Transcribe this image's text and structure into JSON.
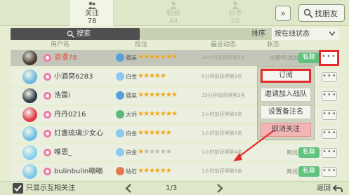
{
  "tabs": [
    {
      "label": "关注",
      "count": "78",
      "icon": "user-icon",
      "active": true
    },
    {
      "label": "粉丝",
      "count": "44",
      "icon": "user-icon",
      "active": false
    },
    {
      "label": "对手",
      "count": "20",
      "icon": "user-icon",
      "active": false
    }
  ],
  "toolbar": {
    "more_label": "»",
    "find_friend_label": "找朋友"
  },
  "search": {
    "placeholder": "搜索",
    "sort_label": "排序",
    "sort_value": "按在线状态"
  },
  "columns": {
    "username": "用户名",
    "rank": "段位",
    "activity": "最近动态",
    "status": "状态"
  },
  "rows": [
    {
      "name": "浪漫78",
      "rank": "猜英",
      "stars_on": 7,
      "stars_total": 7,
      "activity": "14小时前获得第3名",
      "status": "比赛中(团战)",
      "summon": "私聊",
      "avatar_color": "#4a3a30",
      "rank_color": "#5aa0d8",
      "name_red": true
    },
    {
      "name": "小酒窝6283",
      "rank": "白金",
      "stars_on": 5,
      "stars_total": 5,
      "activity": "5分钟前获得第3名",
      "status": "",
      "summon": "",
      "avatar_color": "#6cb7e0",
      "rank_color": "#8ec8f0",
      "name_red": false
    },
    {
      "name": "浩霆i",
      "rank": "猜英",
      "stars_on": 7,
      "stars_total": 7,
      "activity": "35分钟前获得第3名",
      "status": "",
      "summon": "",
      "avatar_color": "#2e3a44",
      "rank_color": "#5aa0d8",
      "name_red": false
    },
    {
      "name": "丹丹0216",
      "rank": "大师",
      "stars_on": 7,
      "stars_total": 7,
      "activity": "1小时前获得第3名",
      "status": "",
      "summon": "",
      "avatar_color": "#e2394a",
      "rank_color": "#5cb87a",
      "name_red": false
    },
    {
      "name": "灯盏琉璃少女心",
      "rank": "白金",
      "stars_on": 6,
      "stars_total": 6,
      "activity": "1小时前获得第2名",
      "status": "",
      "summon": "",
      "avatar_color": "#6cc0e6",
      "rank_color": "#8ec8f0",
      "name_red": false
    },
    {
      "name": "唯恩_",
      "rank": "白金",
      "stars_on": 1,
      "stars_total": 6,
      "activity": "1小时前获得第4名",
      "status": "离线",
      "summon": "私聊",
      "avatar_color": "#84d0ee",
      "rank_color": "#8ec8f0",
      "name_red": false
    },
    {
      "name": "bulinbulin嘣嘣",
      "rank": "钻石",
      "stars_on": 6,
      "stars_total": 6,
      "activity": "1小时前获得第3名",
      "status": "离线",
      "summon": "私聊",
      "avatar_color": "#78c8ea",
      "rank_color": "#e07a4a",
      "name_red": false
    }
  ],
  "row_more_label": "•••",
  "popup": {
    "subscribe": "订阅",
    "invite_team": "邀请加入战队",
    "set_remark": "设置备注名",
    "unfollow": "取消关注"
  },
  "footer": {
    "mutual_only_label": "只显示互相关注",
    "mutual_only_checked": true,
    "page": "1/3",
    "back_label": "返回"
  },
  "colors": {
    "accent_green": "#61c27e",
    "highlight_red": "#e42b2b",
    "star_gold": "#f2a81d",
    "unfollow_pink": "#f3b4b4"
  }
}
